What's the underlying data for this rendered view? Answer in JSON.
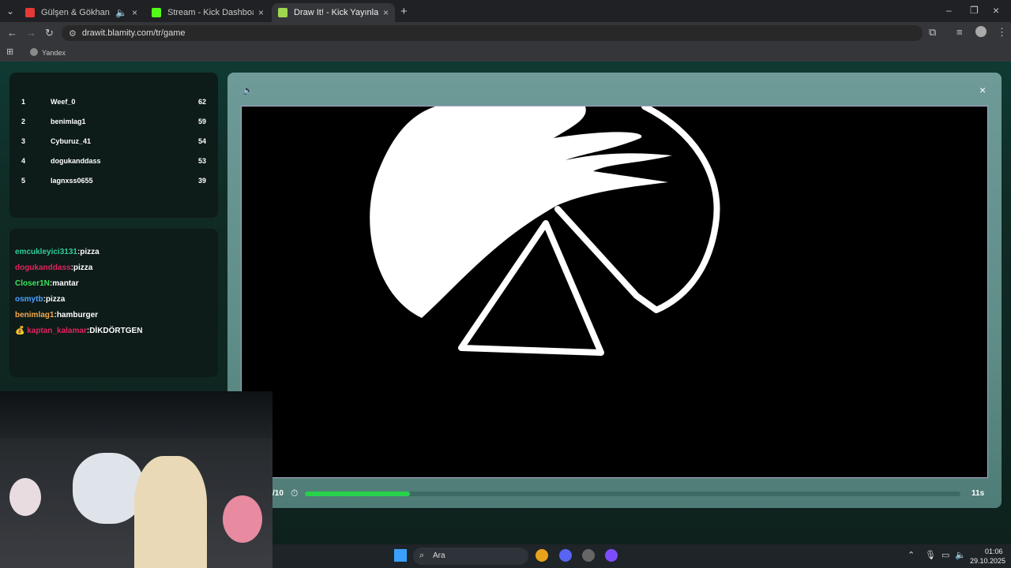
{
  "browser": {
    "tabs": [
      {
        "title": "Gülşen & Gökhan Koşar - B",
        "favicon_color": "#e53935",
        "active": false
      },
      {
        "title": "Stream - Kick Dashboard",
        "favicon_color": "#53fc18",
        "active": false
      },
      {
        "title": "Draw It! - Kick Yayınları İçin Çiz",
        "favicon_color": "#9fd84f",
        "active": true
      }
    ],
    "url": "drawit.blamity.com/tr/game",
    "bookmark": "Yandex"
  },
  "leaderboard": [
    {
      "rank": "1",
      "name": "Weef_0",
      "score": "62"
    },
    {
      "rank": "2",
      "name": "benimlag1",
      "score": "59"
    },
    {
      "rank": "3",
      "name": "Cyburuz_41",
      "score": "54"
    },
    {
      "rank": "4",
      "name": "dogukanddass",
      "score": "53"
    },
    {
      "rank": "5",
      "name": "lagnxss0655",
      "score": "39"
    }
  ],
  "chat": [
    {
      "user": "emcukleyici3131",
      "text": "pizza",
      "color": "#2ecc9a"
    },
    {
      "user": "dogukanddass",
      "text": "pizza",
      "color": "#e0245e"
    },
    {
      "user": "Closer1N",
      "text": "mantar",
      "color": "#3ae55a"
    },
    {
      "user": "osmytb",
      "text": "pizza",
      "color": "#4aa3ff"
    },
    {
      "user": "benimlag1",
      "text": "hamburger",
      "color": "#f3a94e"
    },
    {
      "user": "kaptan_kalamar",
      "text": "DİKDÖRTGEN",
      "color": "#e0245e",
      "badge": "💰"
    }
  ],
  "game": {
    "round_label": "/10",
    "timer": "11s",
    "progress": 0.16
  },
  "taskbar": {
    "search_label": "Ara",
    "time": "01:06",
    "date": "29.10.2025"
  }
}
